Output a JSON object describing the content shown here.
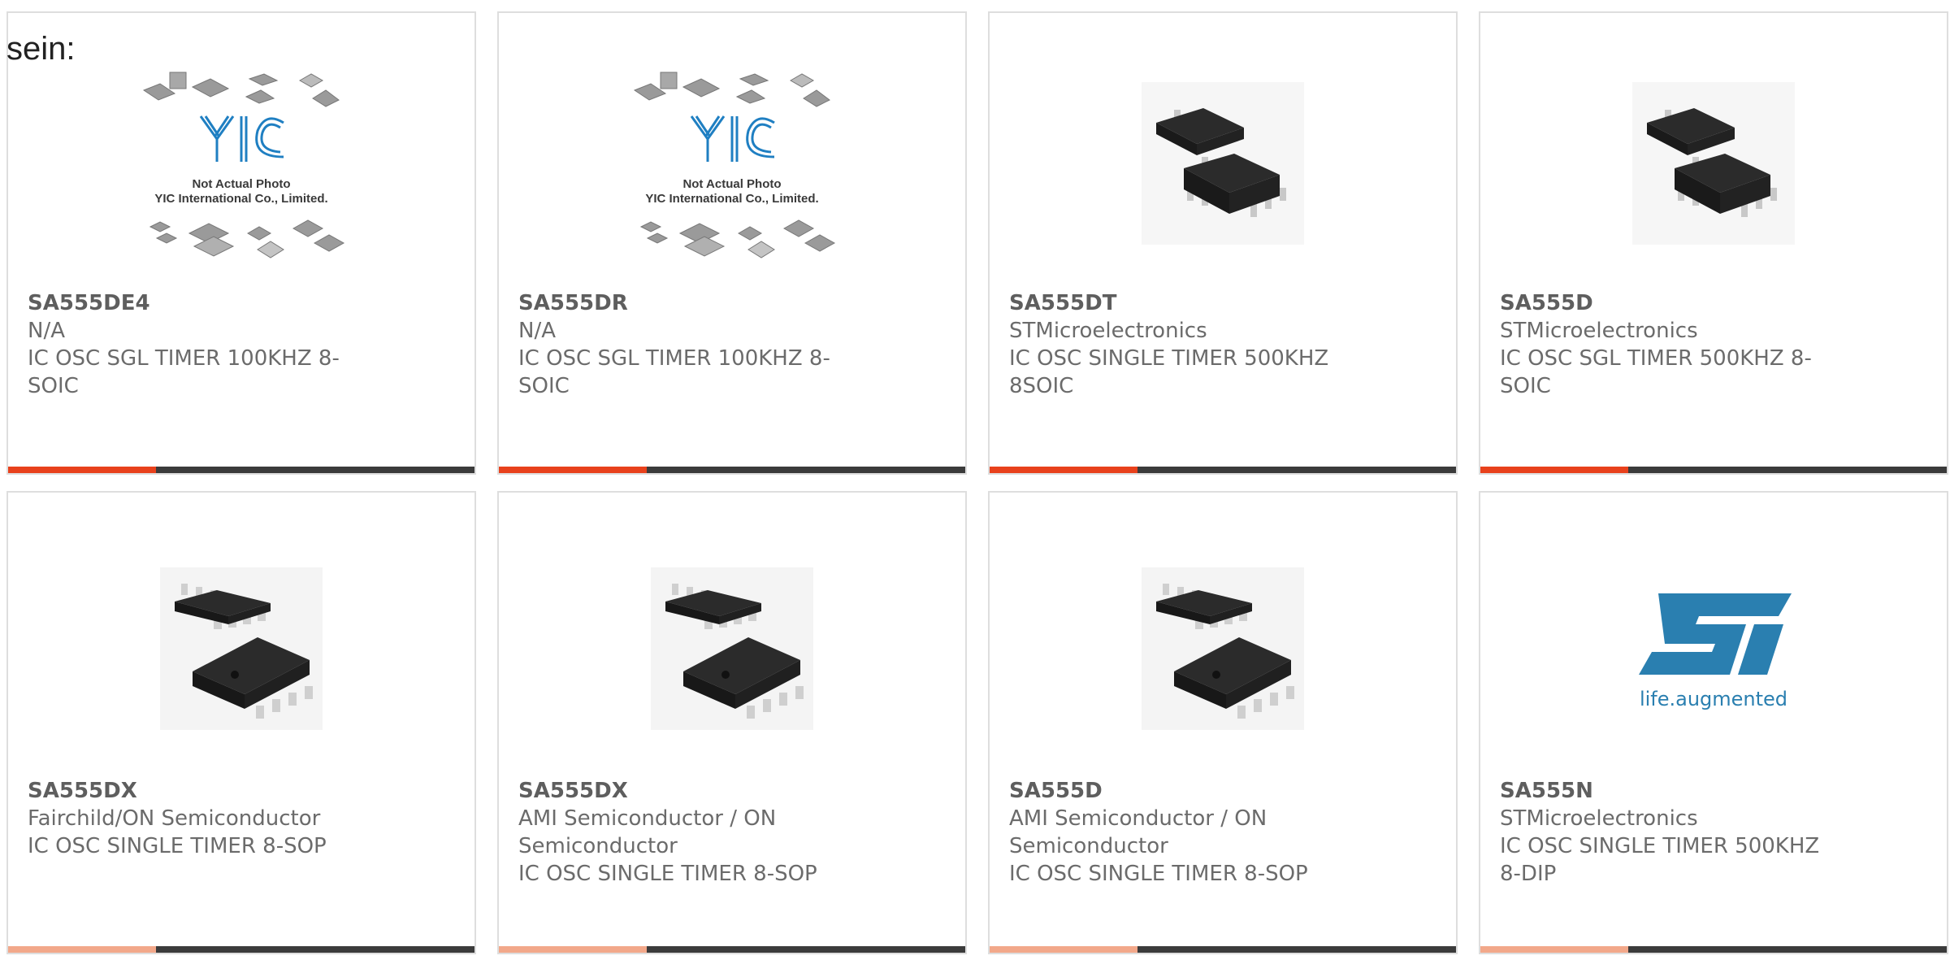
{
  "heading": "sein:",
  "products": [
    {
      "part": "SA555DE4",
      "manufacturer": "N/A",
      "description": "IC OSC SGL TIMER 100KHZ 8-SOIC",
      "image": "yic-placeholder",
      "image_caption": [
        "Not Actual Photo",
        "YIC International Co., Limited."
      ]
    },
    {
      "part": "SA555DR",
      "manufacturer": "N/A",
      "description": "IC OSC SGL TIMER 100KHZ 8-SOIC",
      "image": "yic-placeholder",
      "image_caption": [
        "Not Actual Photo",
        "YIC International Co., Limited."
      ]
    },
    {
      "part": "SA555DT",
      "manufacturer": "STMicroelectronics",
      "description": "IC OSC SINGLE TIMER 500KHZ 8SOIC",
      "image": "soic-8-chip-photo"
    },
    {
      "part": "SA555D",
      "manufacturer": "STMicroelectronics",
      "description": "IC OSC SGL TIMER 500KHZ 8-SOIC",
      "image": "soic-8-chip-photo"
    },
    {
      "part": "SA555DX",
      "manufacturer": "Fairchild/ON Semiconductor",
      "description": "IC OSC SINGLE TIMER 8-SOP",
      "image": "sop-8-chip-photo"
    },
    {
      "part": "SA555DX",
      "manufacturer": "AMI Semiconductor / ON Semiconductor",
      "description": "IC OSC SINGLE TIMER 8-SOP",
      "image": "sop-8-chip-photo"
    },
    {
      "part": "SA555D",
      "manufacturer": "AMI Semiconductor / ON Semiconductor",
      "description": "IC OSC SINGLE TIMER 8-SOP",
      "image": "sop-8-chip-photo"
    },
    {
      "part": "SA555N",
      "manufacturer": "STMicroelectronics",
      "description": "IC OSC SINGLE TIMER 500KHZ 8-DIP",
      "image": "st-logo",
      "logo_text": "life.augmented"
    }
  ],
  "colors": {
    "accent": "#e8411c",
    "bar": "#3b3b3b",
    "st_blue": "#2a7fb0"
  }
}
